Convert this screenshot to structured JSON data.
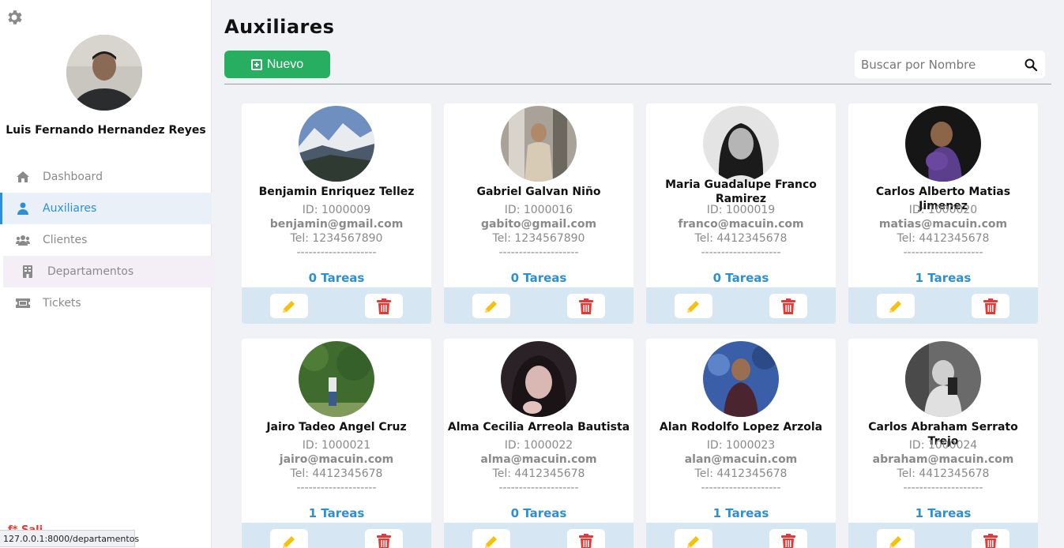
{
  "sidebar": {
    "user_name": "Luis Fernando Hernandez Reyes",
    "items": [
      {
        "label": "Dashboard",
        "icon": "home-icon"
      },
      {
        "label": "Auxiliares",
        "icon": "user-icon"
      },
      {
        "label": "Clientes",
        "icon": "users-icon"
      },
      {
        "label": "Departamentos",
        "icon": "building-icon"
      },
      {
        "label": "Tickets",
        "icon": "ticket-icon"
      }
    ],
    "logout_partial": "f* Sali..."
  },
  "status_url": "127.0.0.1:8000/departamentos",
  "page": {
    "title": "Auxiliares",
    "new_button": "Nuevo",
    "search_placeholder": "Buscar por Nombre"
  },
  "cards": [
    {
      "name": "Benjamin Enriquez Tellez",
      "id": "ID: 1000009",
      "email": "benjamin@gmail.com",
      "tel": "Tel: 1234567890",
      "sep": "--------------------",
      "tareas": "0 Tareas"
    },
    {
      "name": "Gabriel Galvan Niño",
      "id": "ID: 1000016",
      "email": "gabito@gmail.com",
      "tel": "Tel: 1234567890",
      "sep": "--------------------",
      "tareas": "0 Tareas"
    },
    {
      "name": "Maria Guadalupe Franco Ramirez",
      "id": "ID: 1000019",
      "email": "franco@macuin.com",
      "tel": "Tel: 4412345678",
      "sep": "--------------------",
      "tareas": "0 Tareas"
    },
    {
      "name": "Carlos Alberto Matias Jimenez",
      "id": "ID: 1000020",
      "email": "matias@macuin.com",
      "tel": "Tel: 4412345678",
      "sep": "--------------------",
      "tareas": "1 Tareas"
    },
    {
      "name": "Jairo Tadeo Angel Cruz",
      "id": "ID: 1000021",
      "email": "jairo@macuin.com",
      "tel": "Tel: 4412345678",
      "sep": "--------------------",
      "tareas": "1 Tareas"
    },
    {
      "name": "Alma Cecilia Arreola Bautista",
      "id": "ID: 1000022",
      "email": "alma@macuin.com",
      "tel": "Tel: 4412345678",
      "sep": "--------------------",
      "tareas": "0 Tareas"
    },
    {
      "name": "Alan Rodolfo Lopez Arzola",
      "id": "ID: 1000023",
      "email": "alan@macuin.com",
      "tel": "Tel: 4412345678",
      "sep": "--------------------",
      "tareas": "1 Tareas"
    },
    {
      "name": "Carlos Abraham Serrato Trejo",
      "id": "ID: 1000024",
      "email": "abraham@macuin.com",
      "tel": "Tel: 4412345678",
      "sep": "--------------------",
      "tareas": "1 Tareas"
    }
  ],
  "colors": {
    "accent": "#2d8fd5",
    "new_button": "#27ae60",
    "edit_icon": "#f4c20d",
    "delete_icon": "#e53935",
    "card_footer": "#d6e6f3"
  }
}
